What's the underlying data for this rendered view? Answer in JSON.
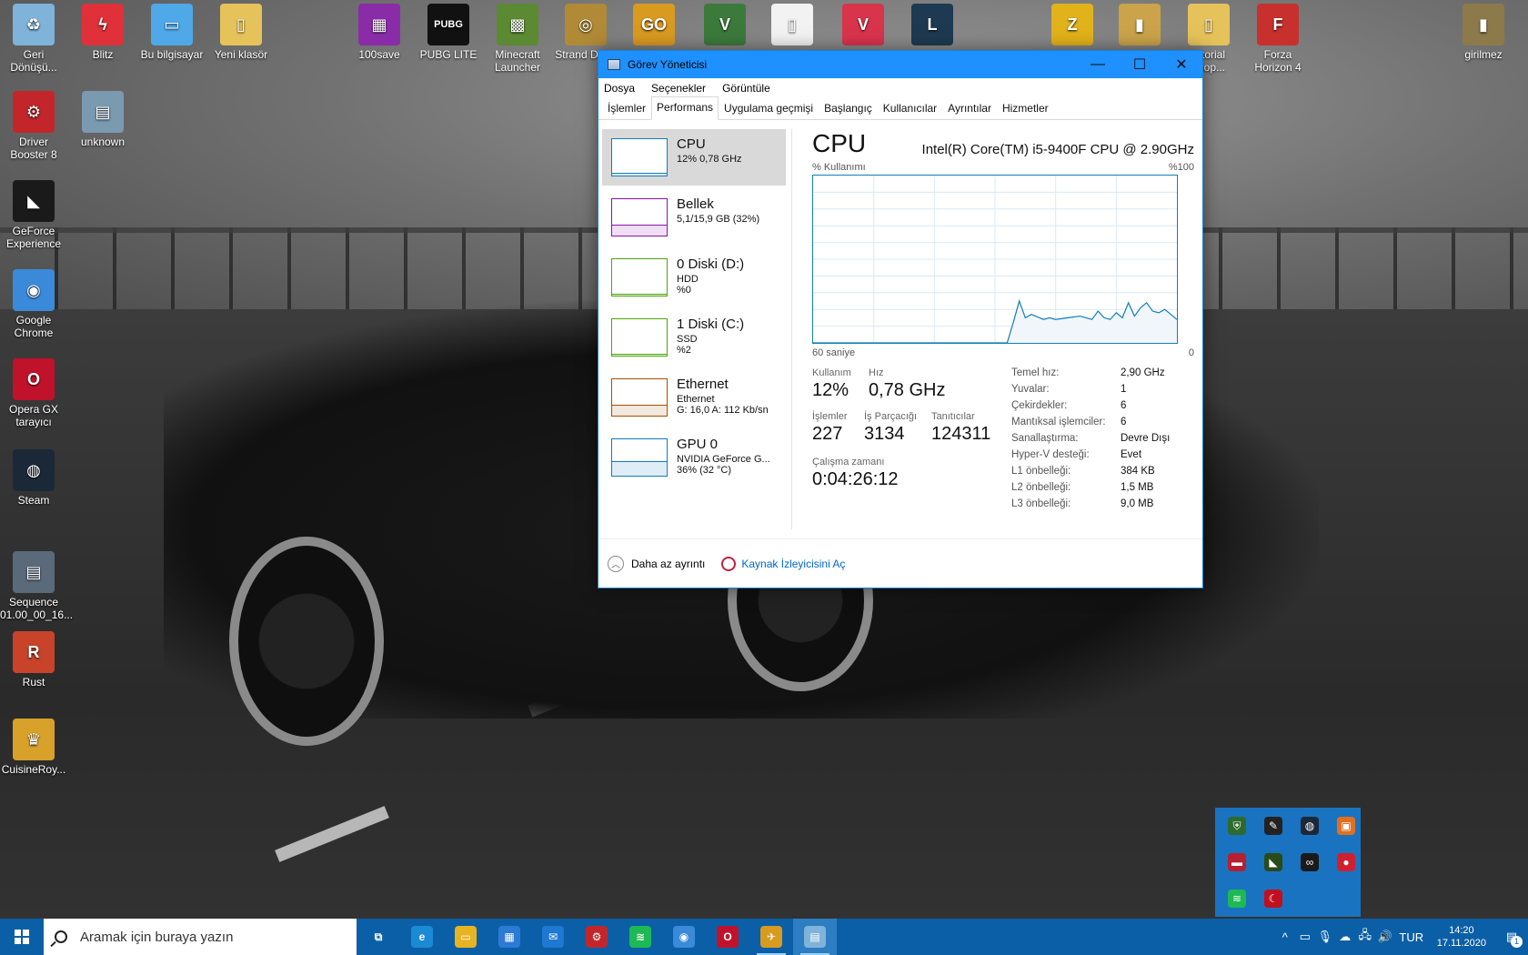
{
  "desktop": {
    "icons": [
      {
        "label": "Geri Dönüşü...",
        "glyph": "♻",
        "color": "#7fb3d9"
      },
      {
        "label": "Blitz",
        "glyph": "ϟ",
        "color": "#e0303a"
      },
      {
        "label": "Bu bilgisayar",
        "glyph": "▭",
        "color": "#4fa8e8"
      },
      {
        "label": "Yeni klasör",
        "glyph": "▯",
        "color": "#e6c25a"
      },
      {
        "label": "100save",
        "glyph": "▦",
        "color": "#8a2ba8"
      },
      {
        "label": "PUBG LITE",
        "glyph": "PUBG",
        "color": "#111111"
      },
      {
        "label": "Minecraft Launcher",
        "glyph": "▩",
        "color": "#5b8a32"
      },
      {
        "label": "Strand Deep",
        "glyph": "◎",
        "color": "#b08a36"
      },
      {
        "label": "GO",
        "glyph": "GO",
        "color": "#d99a20"
      },
      {
        "label": "V",
        "glyph": "V",
        "color": "#3c7a3c"
      },
      {
        "label": "",
        "glyph": "▯",
        "color": "#f2f2f2"
      },
      {
        "label": "",
        "glyph": "V",
        "color": "#d8344c"
      },
      {
        "label": "",
        "glyph": "L",
        "color": "#1e3a52"
      },
      {
        "label": "",
        "glyph": "Z",
        "color": "#e2b21a"
      },
      {
        "label": "",
        "glyph": "▮",
        "color": "#caa34a"
      },
      {
        "label": "tutorial shop...",
        "glyph": "▯",
        "color": "#e6c25a"
      },
      {
        "label": "Forza Horizon 4",
        "glyph": "F",
        "color": "#c8302e"
      },
      {
        "label": "girilmez",
        "glyph": "▮",
        "color": "#8d7a4a"
      },
      {
        "label": "Driver Booster 8",
        "glyph": "⚙",
        "color": "#c3262a"
      },
      {
        "label": "unknown",
        "glyph": "▤",
        "color": "#7a9ab0"
      },
      {
        "label": "GeForce Experience",
        "glyph": "◣",
        "color": "#1a1a1a"
      },
      {
        "label": "Google Chrome",
        "glyph": "◉",
        "color": "#3b8ad9"
      },
      {
        "label": "Opera GX tarayıcı",
        "glyph": "O",
        "color": "#c1122b"
      },
      {
        "label": "Steam",
        "glyph": "◍",
        "color": "#1b2838"
      },
      {
        "label": "Sequence 01.00_00_16...",
        "glyph": "▤",
        "color": "#5a6a7a"
      },
      {
        "label": "Rust",
        "glyph": "R",
        "color": "#c8432a"
      },
      {
        "label": "CuisineRoy...",
        "glyph": "♛",
        "color": "#d7a12a"
      }
    ]
  },
  "window": {
    "title": "Görev Yöneticisi",
    "min_glyph": "—",
    "max_glyph": "☐",
    "close_glyph": "✕",
    "menu": [
      "Dosya",
      "Seçenekler",
      "Görüntüle"
    ],
    "tabs": [
      "İşlemler",
      "Performans",
      "Uygulama geçmişi",
      "Başlangıç",
      "Kullanıcılar",
      "Ayrıntılar",
      "Hizmetler"
    ],
    "active_tab": 1,
    "sidebar": [
      {
        "name": "CPU",
        "line1": "12% 0,78 GHz",
        "line2": "",
        "line3": "",
        "color": "#117dbb"
      },
      {
        "name": "Bellek",
        "line1": "5,1/15,9 GB (32%)",
        "line2": "",
        "line3": "",
        "color": "#8b12ae"
      },
      {
        "name": "0 Diski (D:)",
        "line1": "HDD",
        "line2": "%0",
        "line3": "",
        "color": "#4da60c"
      },
      {
        "name": "1 Diski (C:)",
        "line1": "SSD",
        "line2": "%2",
        "line3": "",
        "color": "#4da60c"
      },
      {
        "name": "Ethernet",
        "line1": "Ethernet",
        "line2": "G: 16,0 A: 112 Kb/sn",
        "line3": "",
        "color": "#a74f01"
      },
      {
        "name": "GPU 0",
        "line1": "NVIDIA GeForce G...",
        "line2": "36% (32 °C)",
        "line3": "",
        "color": "#117dbb"
      }
    ],
    "main": {
      "title": "CPU",
      "model": "Intel(R) Core(TM) i5-9400F CPU @ 2.90GHz",
      "chart_top_left": "% Kullanımı",
      "chart_top_right": "%100",
      "chart_bottom_left": "60 saniye",
      "chart_bottom_right": "0",
      "usage_label": "Kullanım",
      "usage_value": "12%",
      "speed_label": "Hız",
      "speed_value": "0,78 GHz",
      "processes_label": "İşlemler",
      "processes_value": "227",
      "threads_label": "İş Parçacığı",
      "threads_value": "3134",
      "handles_label": "Tanıtıcılar",
      "handles_value": "124311",
      "uptime_label": "Çalışma zamanı",
      "uptime_value": "0:04:26:12",
      "specs": [
        {
          "k": "Temel hız:",
          "v": "2,90 GHz"
        },
        {
          "k": "Yuvalar:",
          "v": "1"
        },
        {
          "k": "Çekirdekler:",
          "v": "6"
        },
        {
          "k": "Mantıksal işlemciler:",
          "v": "6"
        },
        {
          "k": "Sanallaştırma:",
          "v": "Devre Dışı"
        },
        {
          "k": "Hyper-V desteği:",
          "v": "Evet"
        },
        {
          "k": "L1 önbelleği:",
          "v": "384 KB"
        },
        {
          "k": "L2 önbelleği:",
          "v": "1,5 MB"
        },
        {
          "k": "L3 önbelleği:",
          "v": "9,0 MB"
        }
      ]
    },
    "footer": {
      "less_details": "Daha az ayrıntı",
      "resmon_link": "Kaynak İzleyicisini Aç"
    }
  },
  "chart_data": {
    "type": "area",
    "xlabel": "",
    "ylabel": "% Kullanımı",
    "ylim": [
      0,
      100
    ],
    "x": [
      60,
      58,
      56,
      54,
      52,
      50,
      48,
      46,
      44,
      42,
      40,
      38,
      36,
      34,
      32,
      30,
      28,
      27,
      26,
      25,
      24,
      22,
      21,
      20,
      18,
      16,
      14,
      13,
      12,
      11,
      10,
      9,
      8,
      7,
      6,
      5,
      4,
      3,
      2,
      1,
      0
    ],
    "values": [
      0,
      0,
      0,
      0,
      0,
      0,
      0,
      0,
      0,
      0,
      0,
      0,
      0,
      0,
      0,
      0,
      0,
      12,
      25,
      15,
      17,
      14,
      15,
      14,
      15,
      16,
      14,
      19,
      15,
      14,
      18,
      15,
      24,
      16,
      21,
      24,
      19,
      18,
      20,
      17,
      14
    ],
    "grid": true
  },
  "tray_popup": {
    "icons": [
      "shield-icon",
      "bird-icon",
      "steam-icon",
      "app-orange-icon",
      "app-red-icon",
      "nvidia-icon",
      "cc-icon",
      "mic-icon",
      "spotify-icon",
      "crescent-icon"
    ]
  },
  "taskbar": {
    "search_placeholder": "Aramak için buraya yazın",
    "apps": [
      {
        "name": "task-view",
        "glyph": "⧉",
        "color": "transparent"
      },
      {
        "name": "edge",
        "glyph": "e",
        "color": "#1a8ad4"
      },
      {
        "name": "file-explorer",
        "glyph": "▭",
        "color": "#e6b422"
      },
      {
        "name": "store",
        "glyph": "▦",
        "color": "#2c7ad6"
      },
      {
        "name": "mail",
        "glyph": "✉",
        "color": "#1f78d1"
      },
      {
        "name": "driver-booster",
        "glyph": "⚙",
        "color": "#c3262a"
      },
      {
        "name": "spotify",
        "glyph": "≋",
        "color": "#1db954"
      },
      {
        "name": "chrome",
        "glyph": "◉",
        "color": "#3b8ad9"
      },
      {
        "name": "opera-gx",
        "glyph": "O",
        "color": "#c1122b"
      },
      {
        "name": "csgo",
        "glyph": "✈",
        "color": "#d99a20"
      },
      {
        "name": "task-manager",
        "glyph": "▤",
        "color": "#7fb3d9"
      }
    ],
    "tray": {
      "chevron": "^",
      "lang": "TUR",
      "time": "14:20",
      "date": "17.11.2020",
      "notification_count": "1"
    }
  }
}
